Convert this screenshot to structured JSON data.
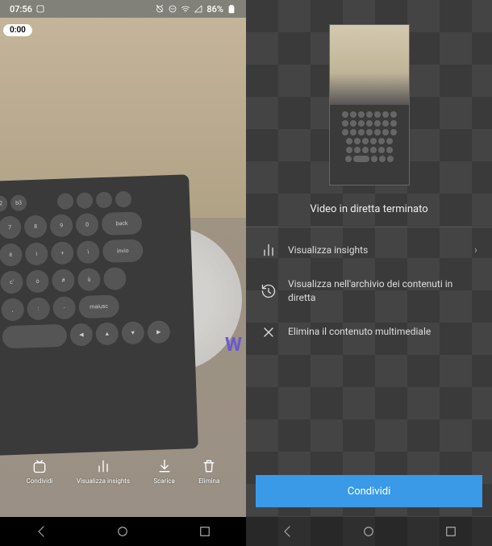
{
  "statusbar": {
    "time": "07:56",
    "battery_pct": "86%"
  },
  "left": {
    "rec_badge": "0:00",
    "actions": {
      "share": "Condividi",
      "insights": "Visualizza insights",
      "download": "Scarica",
      "delete": "Elimina"
    }
  },
  "right": {
    "end_title": "Video in diretta terminato",
    "options": {
      "insights": "Visualizza insights",
      "archive": "Visualizza nell'archivio dei contenuti in diretta",
      "delete": "Elimina il contenuto multimediale"
    },
    "share_button": "Condividi"
  },
  "colors": {
    "primary_button": "#3a9ae8"
  }
}
